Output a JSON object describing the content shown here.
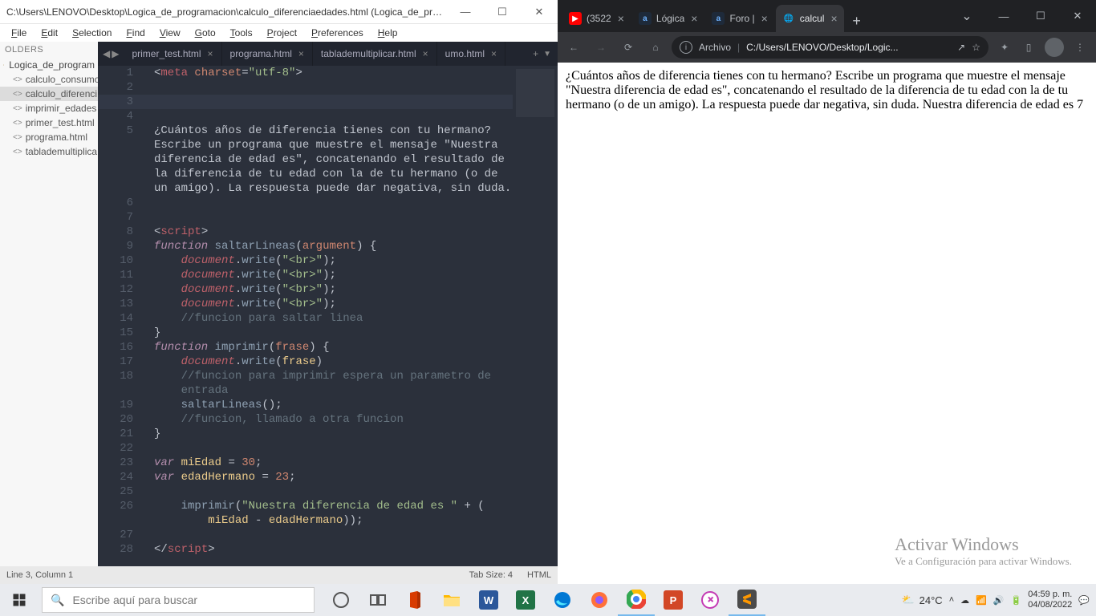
{
  "sublime": {
    "title": "C:\\Users\\LENOVO\\Desktop\\Logica_de_programacion\\calculo_diferenciaedades.html (Logica_de_progra...",
    "menus": [
      "File",
      "Edit",
      "Selection",
      "Find",
      "View",
      "Goto",
      "Tools",
      "Project",
      "Preferences",
      "Help"
    ],
    "sidebar": {
      "heading": "OLDERS",
      "folder": "Logica_de_program",
      "files": [
        "calculo_consumo",
        "calculo_diferenci",
        "imprimir_edades",
        "primer_test.html",
        "programa.html",
        "tablademultiplica"
      ]
    },
    "tabs": [
      "primer_test.html",
      "programa.html",
      "tablademultiplicar.html",
      "umo.html"
    ],
    "code_lines": [
      {
        "n": 1,
        "html": "<span class='tok-punc'>&lt;</span><span class='tok-tag'>meta</span> <span class='tok-attr'>charset</span><span class='tok-punc'>=</span><span class='tok-str'>\"utf-8\"</span><span class='tok-punc'>&gt;</span>"
      },
      {
        "n": 2,
        "html": ""
      },
      {
        "n": 3,
        "html": "",
        "hl": true
      },
      {
        "n": 4,
        "html": ""
      },
      {
        "n": 5,
        "html": "<span class='tok-txt'>¿Cuántos años de diferencia tienes con tu hermano?</span>"
      },
      {
        "n": 0,
        "html": "<span class='tok-txt'>Escribe un programa que muestre el mensaje \"Nuestra</span>"
      },
      {
        "n": 0,
        "html": "<span class='tok-txt'>diferencia de edad es\", concatenando el resultado de</span>"
      },
      {
        "n": 0,
        "html": "<span class='tok-txt'>la diferencia de tu edad con la de tu hermano (o de</span>"
      },
      {
        "n": 0,
        "html": "<span class='tok-txt'>un amigo). La respuesta puede dar negativa, sin duda.</span>"
      },
      {
        "n": 6,
        "html": ""
      },
      {
        "n": 7,
        "html": ""
      },
      {
        "n": 8,
        "html": "<span class='tok-punc'>&lt;</span><span class='tok-tag'>script</span><span class='tok-punc'>&gt;</span>"
      },
      {
        "n": 9,
        "html": "<span class='tok-kw'>function</span> <span class='tok-fn'>saltarLineas</span><span class='tok-punc'>(</span><span class='tok-param'>argument</span><span class='tok-punc'>) {</span>"
      },
      {
        "n": 10,
        "html": "    <span class='tok-obj'>document</span><span class='tok-punc'>.</span><span class='tok-fn'>write</span><span class='tok-punc'>(</span><span class='tok-str'>\"&lt;br&gt;\"</span><span class='tok-punc'>);</span>"
      },
      {
        "n": 11,
        "html": "    <span class='tok-obj'>document</span><span class='tok-punc'>.</span><span class='tok-fn'>write</span><span class='tok-punc'>(</span><span class='tok-str'>\"&lt;br&gt;\"</span><span class='tok-punc'>);</span>"
      },
      {
        "n": 12,
        "html": "    <span class='tok-obj'>document</span><span class='tok-punc'>.</span><span class='tok-fn'>write</span><span class='tok-punc'>(</span><span class='tok-str'>\"&lt;br&gt;\"</span><span class='tok-punc'>);</span>"
      },
      {
        "n": 13,
        "html": "    <span class='tok-obj'>document</span><span class='tok-punc'>.</span><span class='tok-fn'>write</span><span class='tok-punc'>(</span><span class='tok-str'>\"&lt;br&gt;\"</span><span class='tok-punc'>);</span>"
      },
      {
        "n": 14,
        "html": "    <span class='tok-com'>//funcion para saltar linea</span>"
      },
      {
        "n": 15,
        "html": "<span class='tok-punc'>}</span>"
      },
      {
        "n": 16,
        "html": "<span class='tok-kw'>function</span> <span class='tok-fn'>imprimir</span><span class='tok-punc'>(</span><span class='tok-param'>frase</span><span class='tok-punc'>) {</span>"
      },
      {
        "n": 17,
        "html": "    <span class='tok-obj'>document</span><span class='tok-punc'>.</span><span class='tok-fn'>write</span><span class='tok-punc'>(</span><span class='tok-id'>frase</span><span class='tok-punc'>)</span>"
      },
      {
        "n": 18,
        "html": "    <span class='tok-com'>//funcion para imprimir espera un parametro de</span>"
      },
      {
        "n": 0,
        "html": "    <span class='tok-com'>entrada</span>"
      },
      {
        "n": 19,
        "html": "    <span class='tok-fn'>saltarLineas</span><span class='tok-punc'>();</span>"
      },
      {
        "n": 20,
        "html": "    <span class='tok-com'>//funcion, llamado a otra funcion</span>"
      },
      {
        "n": 21,
        "html": "<span class='tok-punc'>}</span>"
      },
      {
        "n": 22,
        "html": ""
      },
      {
        "n": 23,
        "html": "<span class='tok-kw'>var</span> <span class='tok-id'>miEdad</span> <span class='tok-op'>=</span> <span class='tok-num'>30</span><span class='tok-punc'>;</span>"
      },
      {
        "n": 24,
        "html": "<span class='tok-kw'>var</span> <span class='tok-id'>edadHermano</span> <span class='tok-op'>=</span> <span class='tok-num'>23</span><span class='tok-punc'>;</span>"
      },
      {
        "n": 25,
        "html": ""
      },
      {
        "n": 26,
        "html": "    <span class='tok-fn'>imprimir</span><span class='tok-punc'>(</span><span class='tok-str'>\"Nuestra diferencia de edad es \"</span> <span class='tok-op'>+</span> <span class='tok-punc'>(</span>"
      },
      {
        "n": 0,
        "html": "        <span class='tok-id'>miEdad</span> <span class='tok-op'>-</span> <span class='tok-id'>edadHermano</span><span class='tok-punc'>));</span>"
      },
      {
        "n": 27,
        "html": ""
      },
      {
        "n": 28,
        "html": "<span class='tok-punc'>&lt;/</span><span class='tok-tag'>script</span><span class='tok-punc'>&gt;</span>"
      }
    ],
    "status": {
      "pos": "Line 3, Column 1",
      "tab": "Tab Size: 4",
      "lang": "HTML"
    }
  },
  "chrome": {
    "tabs": [
      {
        "label": "(3522",
        "fav": "yt"
      },
      {
        "label": "Lógica",
        "fav": "al"
      },
      {
        "label": "Foro |",
        "fav": "al"
      },
      {
        "label": "calcul",
        "fav": "gl",
        "active": true
      }
    ],
    "url_prefix": "Archivo",
    "url": "C:/Users/LENOVO/Desktop/Logic...",
    "page_text": "¿Cuántos años de diferencia tienes con tu hermano? Escribe un programa que muestre el mensaje \"Nuestra diferencia de edad es\", concatenando el resultado de la diferencia de tu edad con la de tu hermano (o de un amigo). La respuesta puede dar negativa, sin duda. Nuestra diferencia de edad es 7",
    "watermark": {
      "big": "Activar Windows",
      "small": "Ve a Configuración para activar Windows."
    }
  },
  "taskbar": {
    "search_placeholder": "Escribe aquí para buscar",
    "weather": "24°C",
    "time": "04:59 p. m.",
    "date": "04/08/2022"
  }
}
